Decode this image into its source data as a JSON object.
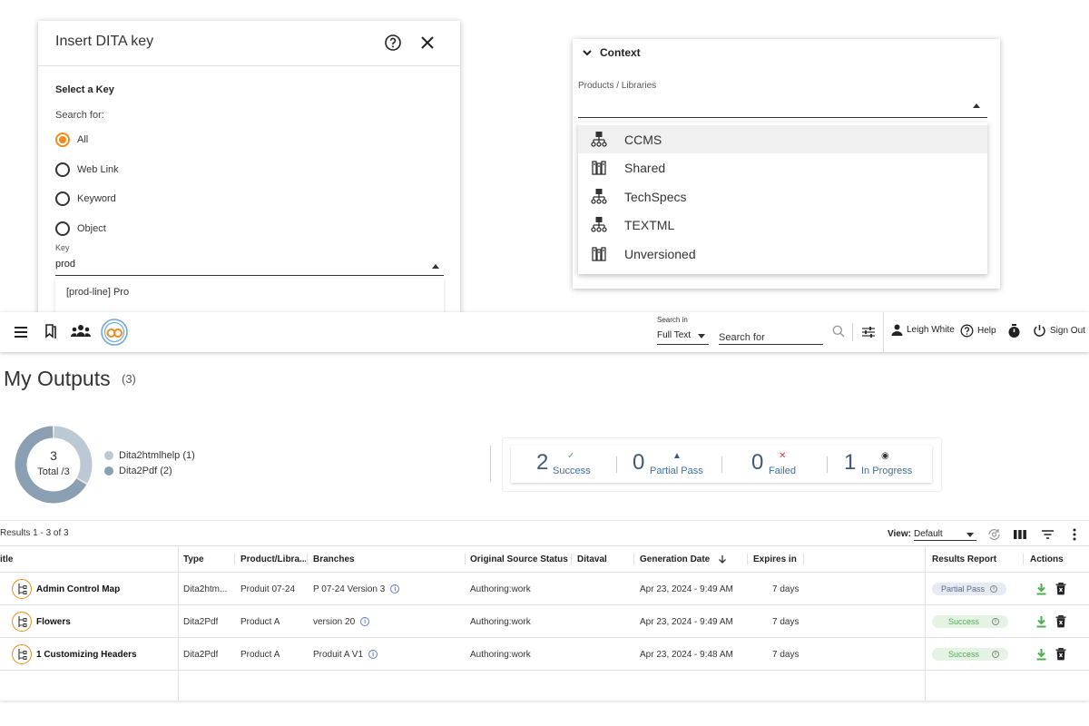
{
  "dialog": {
    "title": "Insert DITA key",
    "section": "Select a Key",
    "search_for": "Search for:",
    "options": [
      "All",
      "Web Link",
      "Keyword",
      "Object"
    ],
    "selected_option": "All",
    "key_label": "Key",
    "key_value": "prod",
    "suggestion": "[prod-line] Pro"
  },
  "context": {
    "header": "Context",
    "field_label": "Products / Libraries",
    "items": [
      {
        "label": "CCMS",
        "icon": "product-tree-icon"
      },
      {
        "label": "Shared",
        "icon": "library-icon"
      },
      {
        "label": "TechSpecs",
        "icon": "product-tree-icon"
      },
      {
        "label": "TEXTML",
        "icon": "product-tree-icon"
      },
      {
        "label": "Unversioned",
        "icon": "library-icon"
      }
    ]
  },
  "appbar": {
    "search_in_label": "Search in",
    "search_in_value": "Full Text",
    "search_placeholder": "Search for",
    "user": "Leigh White",
    "help": "Help",
    "sign_out": "Sign Out"
  },
  "page": {
    "title": "My Outputs",
    "count": "(3)"
  },
  "donut": {
    "center_value": "3",
    "center_label": "Total /3",
    "legend": [
      {
        "label": "Dita2htmlhelp (1)",
        "color": "#bcc8d4",
        "value": 1
      },
      {
        "label": "Dita2Pdf (2)",
        "color": "#8aa0b2",
        "value": 2
      }
    ]
  },
  "stats": [
    {
      "value": "2",
      "label": "Success",
      "symbol": "✓",
      "color": "#4caf50"
    },
    {
      "value": "0",
      "label": "Partial Pass",
      "symbol": "▲",
      "color": "#3e5a7a"
    },
    {
      "value": "0",
      "label": "Failed",
      "symbol": "✕",
      "color": "#e53935"
    },
    {
      "value": "1",
      "label": "In Progress",
      "symbol": "◉",
      "color": "#333333"
    }
  ],
  "toolbar": {
    "results": "Results 1 - 3 of 3",
    "view_label": "View:",
    "view_value": "Default"
  },
  "table": {
    "headers": {
      "title": "itle",
      "type": "Type",
      "product": "Product/Libra...",
      "branches": "Branches",
      "source_status": "Original Source Status",
      "ditaval": "Ditaval",
      "gen_date": "Generation Date",
      "expires": "Expires in",
      "report": "Results Report",
      "actions": "Actions"
    },
    "rows": [
      {
        "title": "Admin Control Map",
        "type": "Dita2htm...",
        "product": "Produit 07-24",
        "branch": "P 07-24 Version 3",
        "status": "Authoring:work",
        "ditaval": "",
        "date": "Apr 23, 2024 - 9:49 AM",
        "expires": "7 days",
        "report": "Partial Pass",
        "report_kind": "partial"
      },
      {
        "title": "Flowers",
        "type": "Dita2Pdf",
        "product": "Product A",
        "branch": "version 20",
        "status": "Authoring:work",
        "ditaval": "",
        "date": "Apr 23, 2024 - 9:49 AM",
        "expires": "7 days",
        "report": "Success",
        "report_kind": "success"
      },
      {
        "title": "1 Customizing Headers",
        "type": "Dita2Pdf",
        "product": "Product A",
        "branch": "Produit A V1",
        "status": "Authoring:work",
        "ditaval": "",
        "date": "Apr 23, 2024 - 9:48 AM",
        "expires": "7 days",
        "report": "Success",
        "report_kind": "success"
      }
    ]
  },
  "colors": {
    "accent": "#f08c1a",
    "stat_blue": "#3e5a7a",
    "download_green": "#4caf50"
  }
}
